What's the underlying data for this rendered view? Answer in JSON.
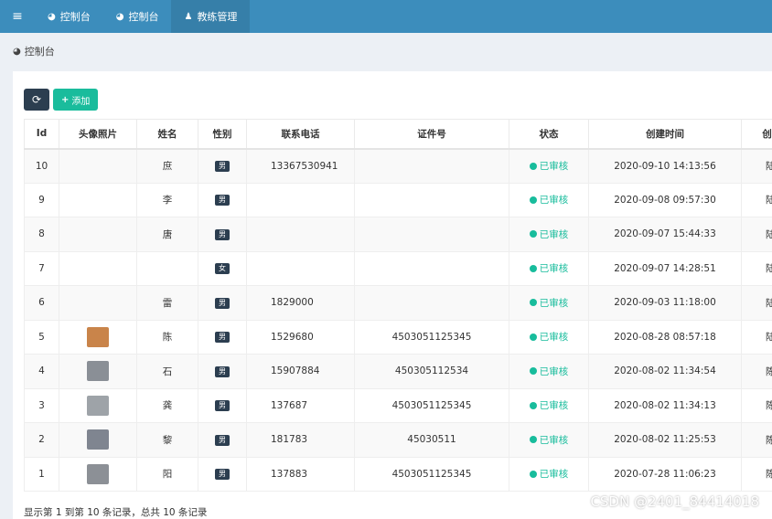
{
  "nav": {
    "tabs": [
      {
        "label": "控制台",
        "icon": "dashboard-icon"
      },
      {
        "label": "控制台",
        "icon": "dashboard-icon"
      },
      {
        "label": "教练管理",
        "icon": "user-icon"
      }
    ]
  },
  "breadcrumb": {
    "label": "控制台"
  },
  "toolbar": {
    "add_label": "添加"
  },
  "table": {
    "headers": [
      "Id",
      "头像照片",
      "姓名",
      "性别",
      "联系电话",
      "证件号",
      "状态",
      "创建时间",
      "创"
    ],
    "rows": [
      {
        "id": "10",
        "name": "庶",
        "sex": "男",
        "phone": "13367530941",
        "idno": "",
        "status": "已审核",
        "created": "2020-09-10 14:13:56",
        "extra": "陆"
      },
      {
        "id": "9",
        "name": "李",
        "sex": "男",
        "phone": "",
        "idno": "",
        "status": "已审核",
        "created": "2020-09-08 09:57:30",
        "extra": "陆"
      },
      {
        "id": "8",
        "name": "唐",
        "sex": "男",
        "phone": "",
        "idno": "",
        "status": "已审核",
        "created": "2020-09-07 15:44:33",
        "extra": "陆"
      },
      {
        "id": "7",
        "name": "",
        "sex": "女",
        "phone": "",
        "idno": "",
        "status": "已审核",
        "created": "2020-09-07 14:28:51",
        "extra": "陆"
      },
      {
        "id": "6",
        "name": "雷",
        "sex": "男",
        "phone": "1829000",
        "idno": "",
        "status": "已审核",
        "created": "2020-09-03 11:18:00",
        "extra": "陆"
      },
      {
        "id": "5",
        "name": "陈",
        "sex": "男",
        "phone": "1529680",
        "idno": "4503051125345",
        "status": "已审核",
        "created": "2020-08-28 08:57:18",
        "extra": "陆"
      },
      {
        "id": "4",
        "name": "石",
        "sex": "男",
        "phone": "15907884",
        "idno": "450305112534",
        "status": "已审核",
        "created": "2020-08-02 11:34:54",
        "extra": "陈"
      },
      {
        "id": "3",
        "name": "龚",
        "sex": "男",
        "phone": "137687",
        "idno": "4503051125345",
        "status": "已审核",
        "created": "2020-08-02 11:34:13",
        "extra": "陈"
      },
      {
        "id": "2",
        "name": "黎",
        "sex": "男",
        "phone": "181783",
        "idno": "45030511",
        "status": "已审核",
        "created": "2020-08-02 11:25:53",
        "extra": "陈"
      },
      {
        "id": "1",
        "name": "阳",
        "sex": "男",
        "phone": "137883",
        "idno": "4503051125345",
        "status": "已审核",
        "created": "2020-07-28 11:06:23",
        "extra": "陈"
      }
    ]
  },
  "footer": {
    "summary": "显示第 1 到第 10 条记录，总共 10 条记录"
  },
  "watermark": "CSDN @2401_84414018",
  "colors": {
    "topbar": "#3c8dbc",
    "status": "#18bc9c",
    "badge": "#2c3e50",
    "add_button": "#1abc9c"
  }
}
